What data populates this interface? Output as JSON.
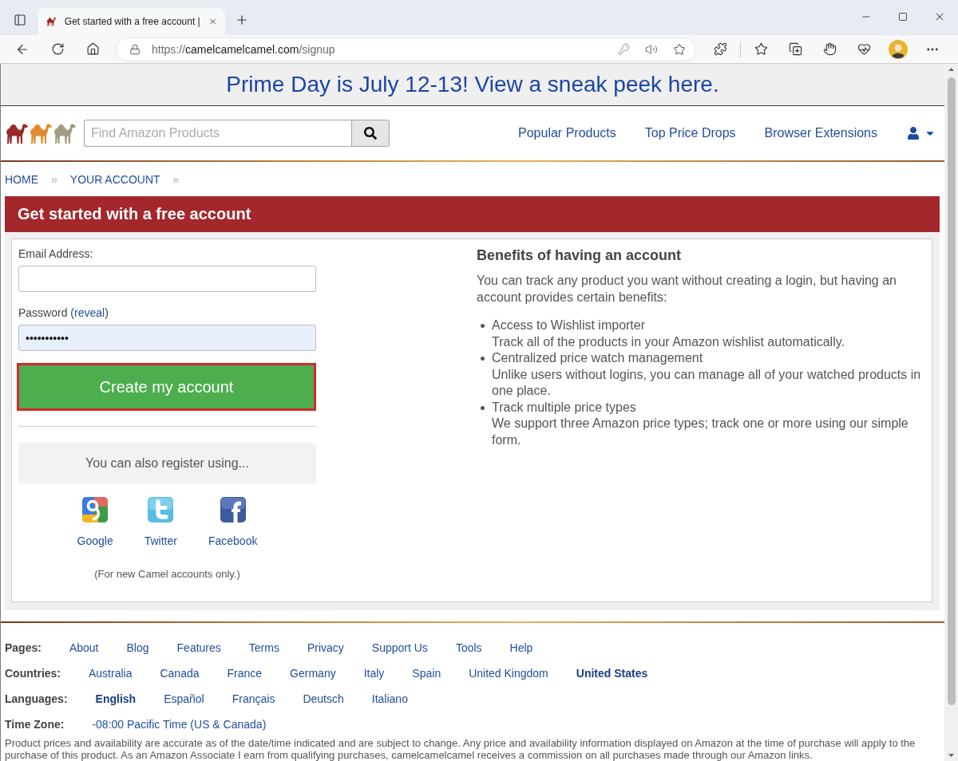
{
  "browser": {
    "tab": {
      "title": "Get started with a free account |"
    },
    "address": {
      "scheme": "https://",
      "host": "camelcamelcamel.com",
      "path": "/signup"
    }
  },
  "banner": {
    "text": "Prime Day is July 12-13! View a sneak peek here."
  },
  "header": {
    "search": {
      "placeholder": "Find Amazon Products"
    },
    "nav": [
      {
        "label": "Popular Products"
      },
      {
        "label": "Top Price Drops"
      },
      {
        "label": "Browser Extensions"
      }
    ]
  },
  "breadcrumbs": [
    {
      "label": "HOME",
      "separator": "»"
    },
    {
      "label": "YOUR ACCOUNT",
      "separator": "»"
    }
  ],
  "signup": {
    "title": "Get started with a free account",
    "fields": [
      {
        "label": "Email Address:",
        "autofilled": false
      },
      {
        "label": "Password (",
        "link": "reveal",
        "label_end": ")",
        "value": "•••••••••••",
        "autofilled": true
      }
    ],
    "submit": {
      "label": "Create my account",
      "highlighted": true
    },
    "alternatives": {
      "heading": "You can also register using...",
      "providers": [
        {
          "kind": "google",
          "label": "Google"
        },
        {
          "kind": "twitter",
          "label": "Twitter"
        },
        {
          "kind": "facebook",
          "label": "Facebook"
        }
      ],
      "note": "(For new Camel accounts only.)"
    }
  },
  "benefits": {
    "title": "Benefits of having an account",
    "intro": "You can track any product you want without creating a login, but having an account provides certain benefits:",
    "items": [
      {
        "title": "Access to Wishlist importer",
        "text": "Track all of the products in your Amazon wishlist automatically."
      },
      {
        "title": "Centralized price watch management",
        "text": "Unlike users without logins, you can manage all of your watched products in one place."
      },
      {
        "title": "Track multiple price types",
        "text": "We support three Amazon price types; track one or more using our simple form."
      }
    ]
  },
  "footer": {
    "rows": [
      {
        "label": "Pages:",
        "links": [
          {
            "text": "About"
          },
          {
            "text": "Blog"
          },
          {
            "text": "Features"
          },
          {
            "text": "Terms"
          },
          {
            "text": "Privacy"
          },
          {
            "text": "Support Us"
          },
          {
            "text": "Tools"
          },
          {
            "text": "Help"
          }
        ]
      },
      {
        "label": "Countries:",
        "links": [
          {
            "text": "Australia",
            "selected": false
          },
          {
            "text": "Canada",
            "selected": false
          },
          {
            "text": "France",
            "selected": false
          },
          {
            "text": "Germany",
            "selected": false
          },
          {
            "text": "Italy",
            "selected": false
          },
          {
            "text": "Spain",
            "selected": false
          },
          {
            "text": "United Kingdom",
            "selected": false
          },
          {
            "text": "United States",
            "selected": true
          }
        ]
      },
      {
        "label": "Languages:",
        "links": [
          {
            "text": "English",
            "selected": true
          },
          {
            "text": "Español",
            "selected": false
          },
          {
            "text": "Français",
            "selected": false
          },
          {
            "text": "Deutsch",
            "selected": false
          },
          {
            "text": "Italiano",
            "selected": false
          }
        ]
      },
      {
        "label": "Time Zone:",
        "links": [
          {
            "text": "-08:00 Pacific Time (US & Canada)"
          }
        ]
      }
    ],
    "disclaimer": "Product prices and availability are accurate as of the date/time indicated and are subject to change. Any price and availability information displayed on Amazon at the time of purchase will apply to the purchase of this product. As an Amazon Associate I earn from qualifying purchases, camelcamelcamel receives a commission on all purchases made through our Amazon links."
  }
}
